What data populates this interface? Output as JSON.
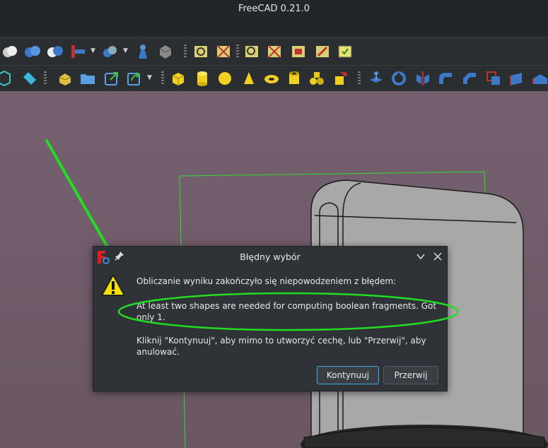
{
  "window": {
    "title": "FreeCAD 0.21.0"
  },
  "toolbar1": {
    "icons": [
      "part-boolean-icon",
      "part-cut-icon",
      "part-fuse-icon",
      "part-common-icon",
      "part-join-icon",
      "part-split-icon",
      "part-compound-icon",
      "part-shape-icon",
      "part-selection-view-icon",
      "part-selection-filter-icon",
      "part-selection-edge-icon",
      "part-selection-face-icon",
      "part-selection-vertex-icon",
      "part-selection-clear-icon"
    ]
  },
  "toolbar2": {
    "icons": [
      "view-box-icon",
      "measure-icon",
      "part-workbench-icon",
      "open-folder-icon",
      "export-icon",
      "redo-icon",
      "cube-icon",
      "cylinder-icon",
      "sphere-icon",
      "cone-icon",
      "torus-icon",
      "tube-icon",
      "primitives-icon",
      "shape-builder-icon",
      "extrude-icon",
      "revolve-icon",
      "mirror-icon",
      "fillet-icon",
      "chamfer-icon",
      "make-face-icon",
      "ruled-surface-icon",
      "loft-icon"
    ]
  },
  "dialog": {
    "title": "Błędny wybór",
    "message_intro": "Obliczanie wyniku zakończyło się niepowodzeniem z błędem:",
    "message_error": "At least two shapes are needed for computing boolean fragments. Got only 1.",
    "message_hint": "Kliknij \"Kontynuuj\", aby mimo to utworzyć cechę, lub \"Przerwij\", aby anulować.",
    "continue_label": "Kontynuuj",
    "abort_label": "Przerwij"
  },
  "colors": {
    "window_bg": "#232629",
    "toolbar_bg": "#2b2e31",
    "viewport_bg": "#6b5a66",
    "dialog_bg": "#2f3236",
    "accent": "#3daee9",
    "annotation": "#22dd22"
  }
}
